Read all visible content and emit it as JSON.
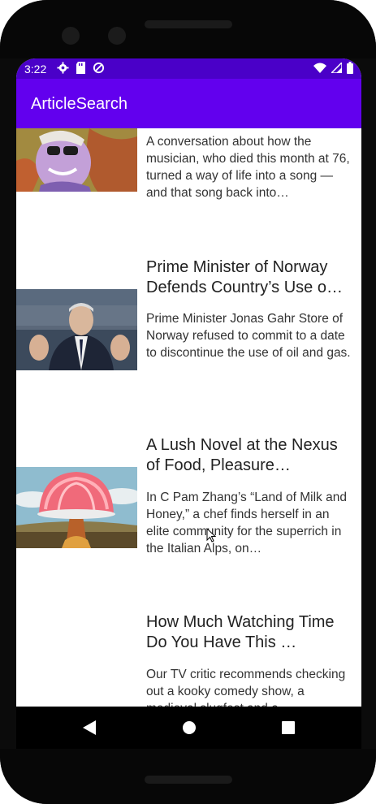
{
  "status_bar": {
    "time": "3:22",
    "left_icons": [
      "gear-icon",
      "sd-card-icon",
      "data-saver-icon"
    ],
    "right_icons": [
      "wifi-icon",
      "signal-icon",
      "battery-icon"
    ]
  },
  "app_bar": {
    "title": "ArticleSearch"
  },
  "articles": [
    {
      "headline": "",
      "abstract": "A conversation about how the musician, who died this month at 76, turned a way of life into a song — and that song back into…",
      "thumbnail": "musician-portrait-thumbnail"
    },
    {
      "headline": "Prime Minister of Norway Defends Country’s Use o…",
      "abstract": "Prime Minister Jonas Gahr Store of Norway refused to commit to a date to discontinue the use of oil and gas.",
      "thumbnail": "prime-minister-thumbnail"
    },
    {
      "headline": "A Lush Novel at the Nexus of Food, Pleasure…",
      "abstract": "In C Pam Zhang’s “Land of Milk and Honey,” a chef finds herself in an elite community for the superrich in the Italian Alps, on…",
      "thumbnail": "jelly-mushroom-cloud-thumbnail"
    },
    {
      "headline": "How Much Watching Time Do You Have This …",
      "abstract": "Our TV critic recommends checking out a kooky comedy show, a medieval slugfest and a…",
      "thumbnail": ""
    }
  ],
  "nav_bar": {
    "buttons": [
      "back-icon",
      "home-icon",
      "recents-icon"
    ]
  },
  "colors": {
    "status_bar": "#4a00c8",
    "app_bar": "#6200ee",
    "background": "#ffffff"
  }
}
